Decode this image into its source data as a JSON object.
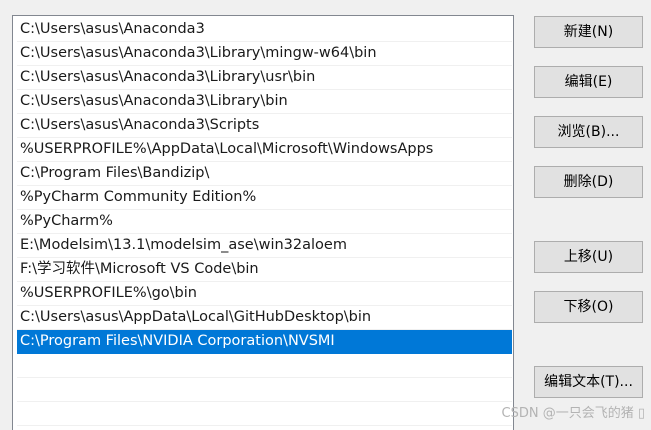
{
  "path_list": {
    "items": [
      "C:\\Users\\asus\\Anaconda3",
      "C:\\Users\\asus\\Anaconda3\\Library\\mingw-w64\\bin",
      "C:\\Users\\asus\\Anaconda3\\Library\\usr\\bin",
      "C:\\Users\\asus\\Anaconda3\\Library\\bin",
      "C:\\Users\\asus\\Anaconda3\\Scripts",
      "%USERPROFILE%\\AppData\\Local\\Microsoft\\WindowsApps",
      "C:\\Program Files\\Bandizip\\",
      "%PyCharm Community Edition%",
      "%PyCharm%",
      "E:\\Modelsim\\13.1\\modelsim_ase\\win32aloem",
      "F:\\学习软件\\Microsoft VS Code\\bin",
      "%USERPROFILE%\\go\\bin",
      "C:\\Users\\asus\\AppData\\Local\\GitHubDesktop\\bin",
      "C:\\Program Files\\NVIDIA Corporation\\NVSMI",
      "",
      "",
      ""
    ],
    "selected_index": 13,
    "selection_color": "#0078d7"
  },
  "buttons": {
    "new": "新建(N)",
    "edit": "编辑(E)",
    "browse": "浏览(B)...",
    "delete": "删除(D)",
    "move_up": "上移(U)",
    "move_down": "下移(O)",
    "edit_text": "编辑文本(T)..."
  },
  "watermark": "CSDN @一只会飞的猪 ▯"
}
